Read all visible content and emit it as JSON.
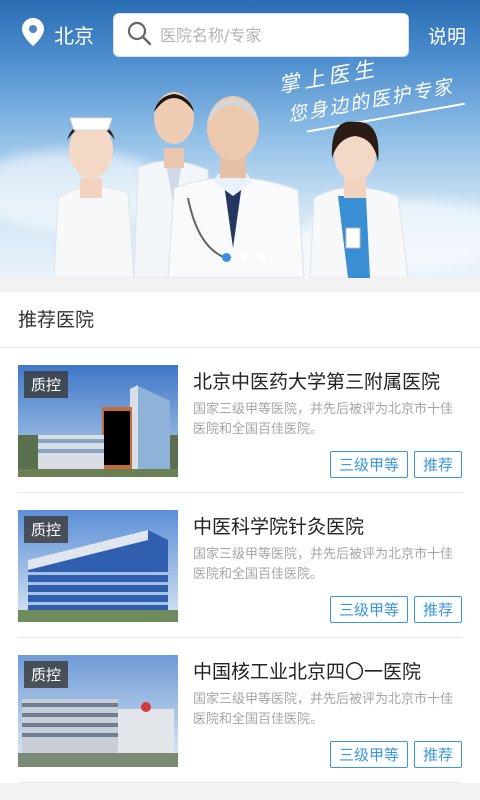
{
  "header": {
    "city": "北京",
    "search_placeholder": "医院名称/专家",
    "explain_label": "说明",
    "icons": {
      "location": "location-pin-icon",
      "search": "search-icon"
    }
  },
  "banner": {
    "slogan_line1": "掌上医生",
    "slogan_line2": "您身边的医护专家",
    "slide_count": 3,
    "active_slide": 1
  },
  "recommended": {
    "title": "推荐医院",
    "hospitals": [
      {
        "badge": "质控",
        "name": "北京中医药大学第三附属医院",
        "desc": "国家三级甲等医院，并先后被评为北京市十佳医院和全国百佳医院。",
        "tags": [
          "三级甲等",
          "推荐"
        ]
      },
      {
        "badge": "质控",
        "name": "中医科学院针灸医院",
        "desc": "国家三级甲等医院，并先后被评为北京市十佳医院和全国百佳医院。",
        "tags": [
          "三级甲等",
          "推荐"
        ]
      },
      {
        "badge": "质控",
        "name": "中国核工业北京四〇一医院",
        "desc": "国家三级甲等医院，并先后被评为北京市十佳医院和全国百佳医院。",
        "tags": [
          "三级甲等",
          "推荐"
        ]
      }
    ]
  },
  "colors": {
    "accent": "#3a96e0",
    "header_blue": "#2a6db4"
  }
}
